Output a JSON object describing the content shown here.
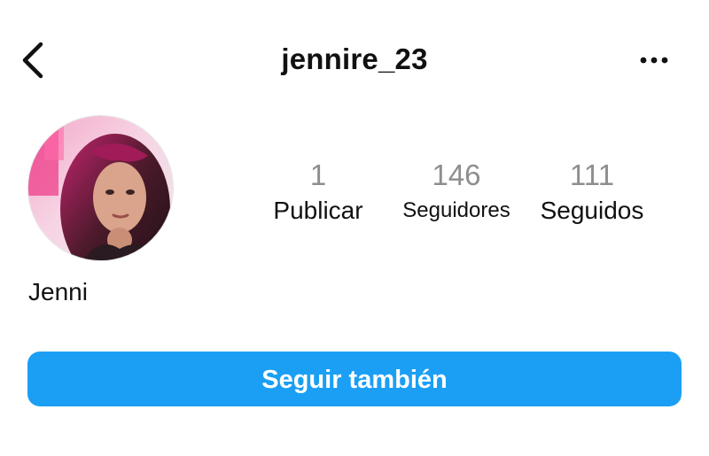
{
  "header": {
    "title": "jennire_23",
    "back_icon": "chevron-left-icon",
    "more_icon": "more-horizontal-icon"
  },
  "profile": {
    "display_name": "Jenni",
    "stats": [
      {
        "value": "1",
        "label": "Publicar"
      },
      {
        "value": "146",
        "label": "Seguidores"
      },
      {
        "value": "111",
        "label": "Seguidos"
      }
    ]
  },
  "actions": {
    "follow_label": "Seguir también"
  },
  "colors": {
    "accent": "#1b9ff5",
    "muted_number": "#8e8e8e",
    "text": "#111111"
  }
}
